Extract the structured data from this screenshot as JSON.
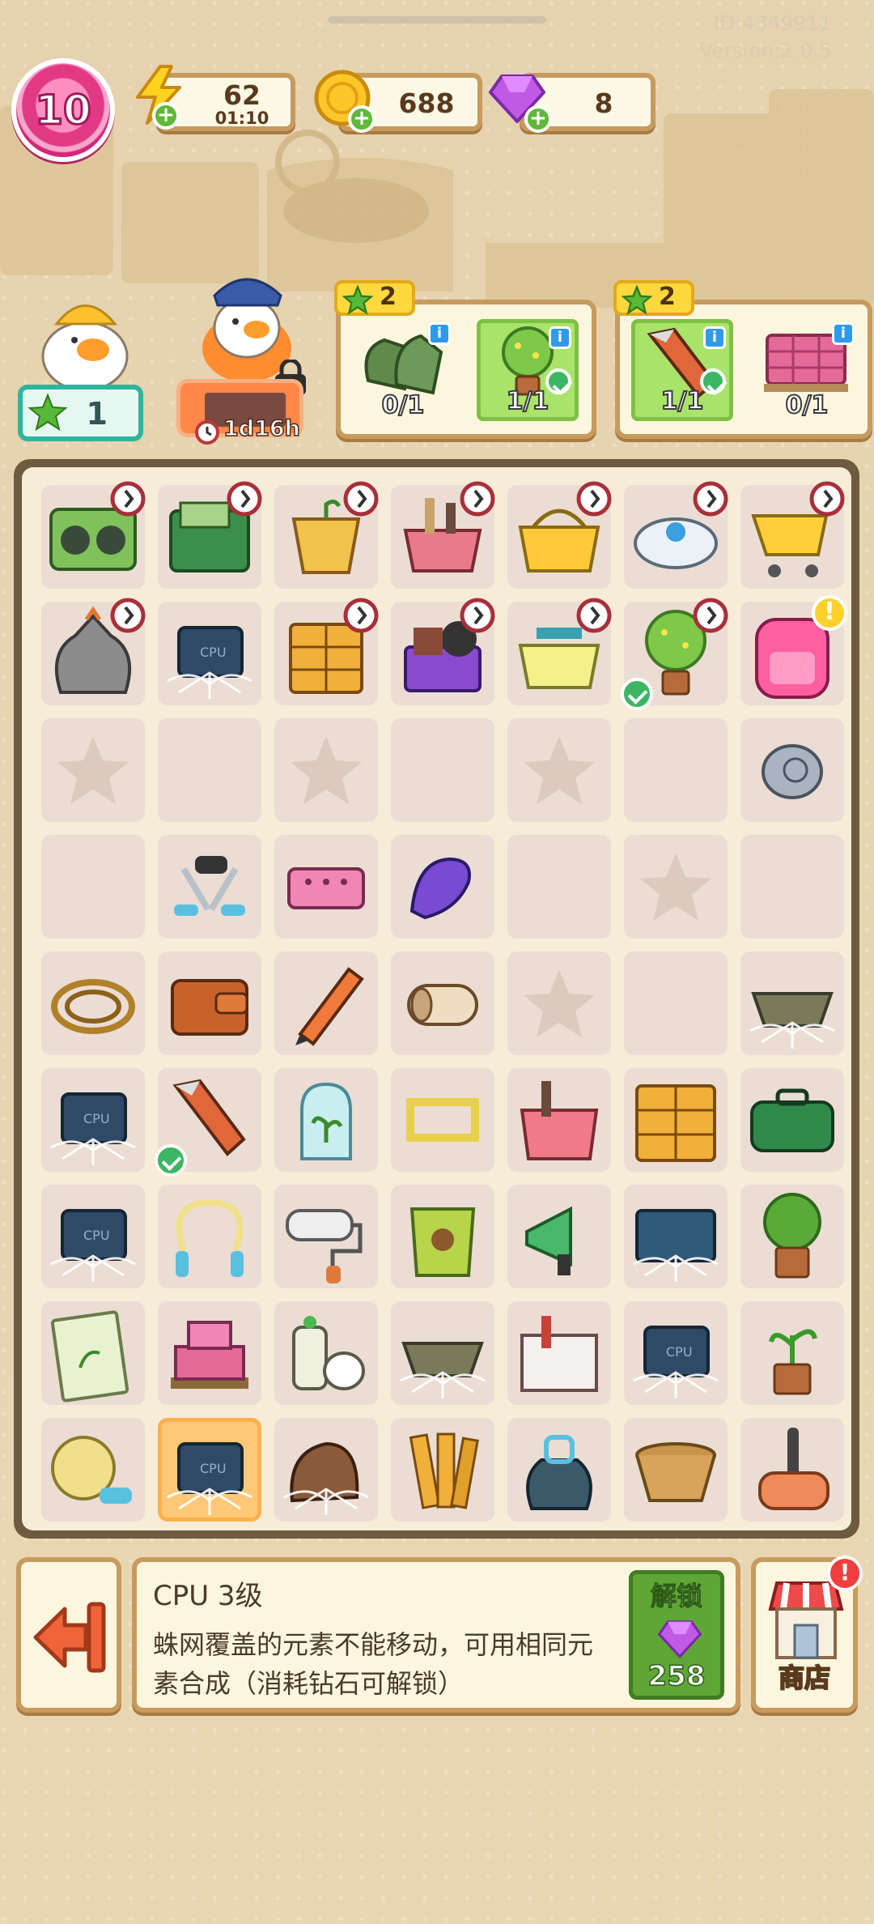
{
  "header": {
    "player_id": "ID:4349911",
    "version": "Version:2.0.5",
    "level": "10",
    "energy": "62",
    "energy_timer": "01:10",
    "coins": "688",
    "gems": "8",
    "plus_icon": "plus-icon"
  },
  "characters": {
    "star_count": "1",
    "visitor_timer": "1d16h"
  },
  "orders": [
    {
      "stars": "2",
      "items": [
        {
          "name": "gloves",
          "count": "0/1",
          "done": false
        },
        {
          "name": "potted-tree",
          "count": "1/1",
          "done": true
        }
      ]
    },
    {
      "stars": "2",
      "items": [
        {
          "name": "box-cutter",
          "count": "1/1",
          "done": true
        },
        {
          "name": "brick-pallet",
          "count": "0/1",
          "done": false
        }
      ]
    }
  ],
  "board": {
    "rows": [
      [
        "radio",
        "toolbox-cash",
        "flower-pot",
        "tool-basket",
        "shopping-basket",
        "robot-vacuum",
        "shopping-cart"
      ],
      [
        "garbage-bag",
        "cpu-web",
        "cabinet",
        "purple-basket",
        "dumbbell-basket",
        "potted-tree",
        "backpack"
      ],
      [
        "empty-star",
        "empty",
        "empty-star",
        "empty",
        "empty-star",
        "empty",
        "snail-shell"
      ],
      [
        "empty",
        "grip-trainer",
        "pink-brick",
        "purple-clip",
        "empty",
        "empty-star",
        "empty"
      ],
      [
        "rope",
        "wallet",
        "pencil",
        "paper-roll",
        "empty-star",
        "empty",
        "tray-web"
      ],
      [
        "cpu-web",
        "box-cutter",
        "plant-jar",
        "yellow-frame",
        "tool-crate",
        "drawer-cabinet",
        "green-case"
      ],
      [
        "cpu-web",
        "jump-rope",
        "paint-roller",
        "seed-bag",
        "megaphone",
        "circuit-web",
        "bush-pot"
      ],
      [
        "plant-manual",
        "brick-pile",
        "spray-cans",
        "tray-web",
        "tool-box",
        "cpu-web",
        "sprout-pot"
      ],
      [
        "yarn-ball",
        "cpu-web-selected",
        "glove-web",
        "wood-planks",
        "gym-bag",
        "wicker-basket",
        "mallet"
      ]
    ]
  },
  "bottom": {
    "item_title": "CPU 3级",
    "item_desc": "蛛网覆盖的元素不能移动，可用相同元素合成（消耗钻石可解锁）",
    "unlock_label": "解锁",
    "unlock_cost": "258",
    "shop_label": "商店",
    "shop_badge": "!",
    "exit_icon": "exit-icon"
  }
}
